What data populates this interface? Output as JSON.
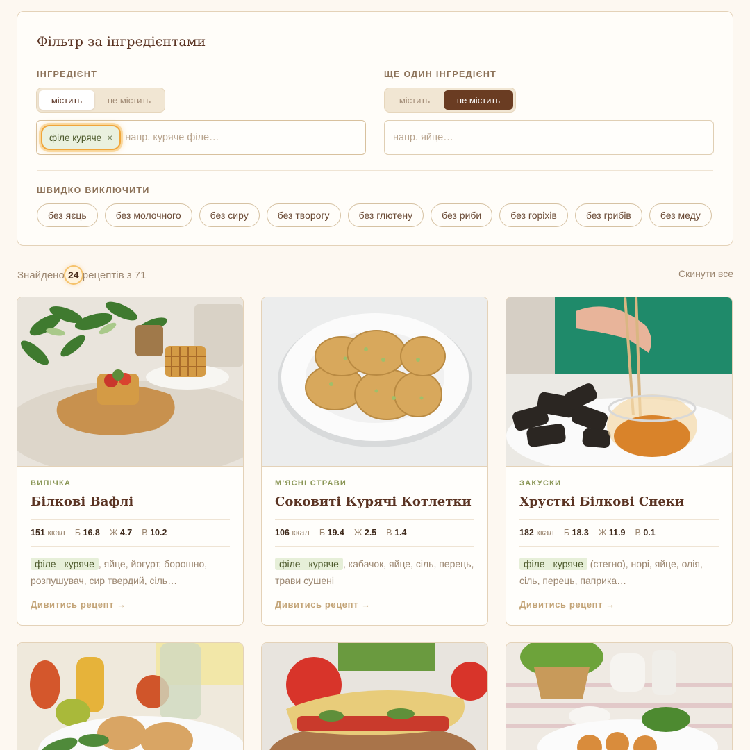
{
  "filter": {
    "title": "Фільтр за інгредієнтами",
    "ingredient1": {
      "label": "ІНГРЕДІЄНТ",
      "toggle": [
        "містить",
        "не містить"
      ],
      "active": "містить",
      "chip": "філе куряче",
      "chip_remove": "×",
      "placeholder": "напр. куряче філе…"
    },
    "ingredient2": {
      "label": "ЩЕ ОДИН ІНГРЕДІЄНТ",
      "toggle": [
        "містить",
        "не містить"
      ],
      "active": "не містить",
      "placeholder": "напр. яйце…"
    },
    "quick_exclude": {
      "label": "ШВИДКО ВИКЛЮЧИТИ",
      "items": [
        "без яєць",
        "без молочного",
        "без сиру",
        "без творогу",
        "без глютену",
        "без риби",
        "без горіхів",
        "без грибів",
        "без меду"
      ]
    }
  },
  "results": {
    "prefix": "Знайдено",
    "count": "24",
    "suffix": "рецептів з 71",
    "reset": "Скинути все"
  },
  "recipes": [
    {
      "category": "ВИПІЧКА",
      "title": "Білкові Вафлі",
      "kcal": "151",
      "kcal_unit": "ккал",
      "b_label": "Б",
      "b": "16.8",
      "zh_label": "Ж",
      "zh": "4.7",
      "v_label": "В",
      "v": "10.2",
      "highlight": "філе куряче",
      "rest": ", яйце, йогурт, борошно, розпушувач, сир твердий, сіль…",
      "link": "Дивитись рецепт →"
    },
    {
      "category": "М'ЯСНІ СТРАВИ",
      "title": "Соковиті Курячі Котлетки",
      "kcal": "106",
      "kcal_unit": "ккал",
      "b_label": "Б",
      "b": "19.4",
      "zh_label": "Ж",
      "zh": "2.5",
      "v_label": "В",
      "v": "1.4",
      "highlight": "філе куряче",
      "rest": ", кабачок, яйце, сіль, перець, трави сушені",
      "link": "Дивитись рецепт →"
    },
    {
      "category": "ЗАКУСКИ",
      "title": "Хрусткі Білкові Снеки",
      "kcal": "182",
      "kcal_unit": "ккал",
      "b_label": "Б",
      "b": "18.3",
      "zh_label": "Ж",
      "zh": "11.9",
      "v_label": "В",
      "v": "0.1",
      "highlight": "філе куряче",
      "rest": " (стегно), норі, яйце, олія, сіль, перець, паприка…",
      "link": "Дивитись рецепт →"
    }
  ],
  "colors": {
    "background": "#fdf8f1",
    "accent_dark": "#6a3c22",
    "highlight_glow": "#f0a53a",
    "category_green": "#8a9656",
    "chip_green": "#e6efd8"
  }
}
